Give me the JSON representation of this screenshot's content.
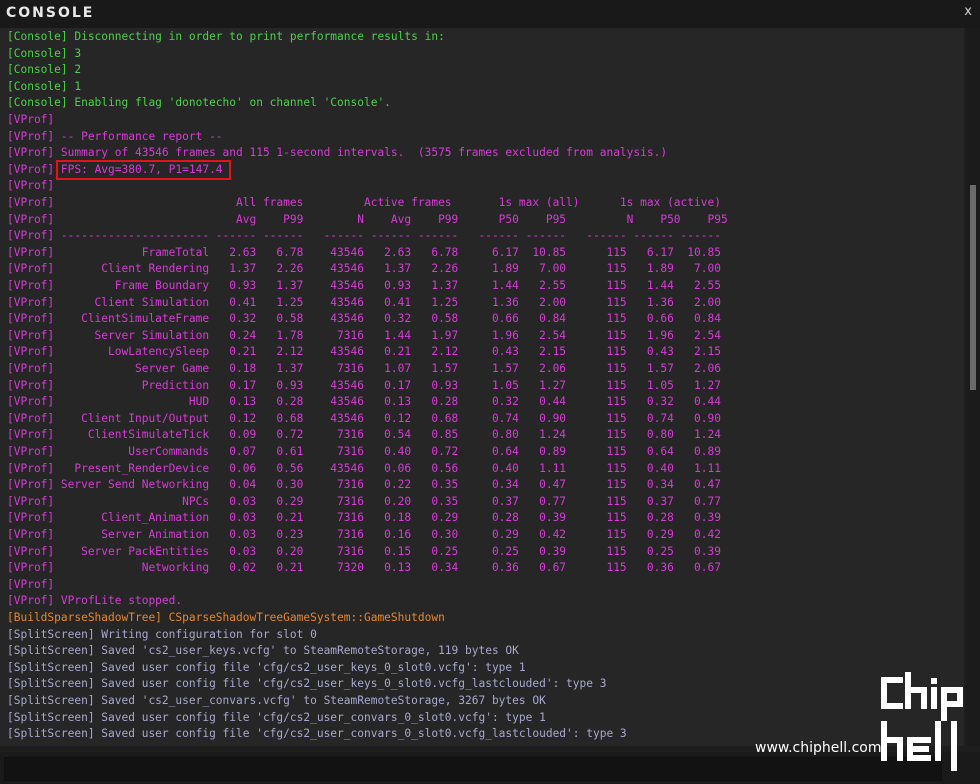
{
  "window": {
    "title": "CONSOLE",
    "close_label": "x"
  },
  "colors": {
    "console_green": "#4ad24a",
    "vprof_magenta": "#d63cd6",
    "shadow_orange": "#e8862a",
    "splitscreen_lavender": "#a8a8cf",
    "highlight_red": "#e0151b",
    "background": "#262626"
  },
  "console_lines": [
    "[Console] Disconnecting in order to print performance results in:",
    "[Console] 3",
    "[Console] 2",
    "[Console] 1",
    "[Console] Enabling flag 'donotecho' on channel 'Console'."
  ],
  "vprof_intro": [
    "[VProf]",
    "[VProf] -- Performance report --",
    "[VProf] Summary of 43546 frames and 115 1-second intervals.  (3575 frames excluded from analysis.)"
  ],
  "fps": {
    "prefix": "[VProf] ",
    "text": "FPS: Avg=380.7, P1=147.4"
  },
  "blank_vprof": "[VProf]",
  "table": {
    "header1": "[VProf]                           All frames         Active frames       1s max (all)      1s max (active)",
    "header2": "[VProf]                           Avg    P99        N    Avg    P99      P50    P95         N    P50    P95",
    "separator": "[VProf] ---------------------- ------ ------   ------ ------ ------   ------ ------   ------ ------ ------",
    "rows": [
      {
        "name": "FrameTotal",
        "avg": "2.63",
        "p99": "6.78",
        "n": "43546",
        "act_avg": "2.63",
        "act_p99": "6.78",
        "max_p50": "6.17",
        "max_p95": "10.85",
        "act_n": "115",
        "act_p50": "6.17",
        "act_p95": "10.85"
      },
      {
        "name": "Client Rendering",
        "avg": "1.37",
        "p99": "2.26",
        "n": "43546",
        "act_avg": "1.37",
        "act_p99": "2.26",
        "max_p50": "1.89",
        "max_p95": "7.00",
        "act_n": "115",
        "act_p50": "1.89",
        "act_p95": "7.00"
      },
      {
        "name": "Frame Boundary",
        "avg": "0.93",
        "p99": "1.37",
        "n": "43546",
        "act_avg": "0.93",
        "act_p99": "1.37",
        "max_p50": "1.44",
        "max_p95": "2.55",
        "act_n": "115",
        "act_p50": "1.44",
        "act_p95": "2.55"
      },
      {
        "name": "Client Simulation",
        "avg": "0.41",
        "p99": "1.25",
        "n": "43546",
        "act_avg": "0.41",
        "act_p99": "1.25",
        "max_p50": "1.36",
        "max_p95": "2.00",
        "act_n": "115",
        "act_p50": "1.36",
        "act_p95": "2.00"
      },
      {
        "name": "ClientSimulateFrame",
        "avg": "0.32",
        "p99": "0.58",
        "n": "43546",
        "act_avg": "0.32",
        "act_p99": "0.58",
        "max_p50": "0.66",
        "max_p95": "0.84",
        "act_n": "115",
        "act_p50": "0.66",
        "act_p95": "0.84"
      },
      {
        "name": "Server Simulation",
        "avg": "0.24",
        "p99": "1.78",
        "n": "7316",
        "act_avg": "1.44",
        "act_p99": "1.97",
        "max_p50": "1.96",
        "max_p95": "2.54",
        "act_n": "115",
        "act_p50": "1.96",
        "act_p95": "2.54"
      },
      {
        "name": "LowLatencySleep",
        "avg": "0.21",
        "p99": "2.12",
        "n": "43546",
        "act_avg": "0.21",
        "act_p99": "2.12",
        "max_p50": "0.43",
        "max_p95": "2.15",
        "act_n": "115",
        "act_p50": "0.43",
        "act_p95": "2.15"
      },
      {
        "name": "Server Game",
        "avg": "0.18",
        "p99": "1.37",
        "n": "7316",
        "act_avg": "1.07",
        "act_p99": "1.57",
        "max_p50": "1.57",
        "max_p95": "2.06",
        "act_n": "115",
        "act_p50": "1.57",
        "act_p95": "2.06"
      },
      {
        "name": "Prediction",
        "avg": "0.17",
        "p99": "0.93",
        "n": "43546",
        "act_avg": "0.17",
        "act_p99": "0.93",
        "max_p50": "1.05",
        "max_p95": "1.27",
        "act_n": "115",
        "act_p50": "1.05",
        "act_p95": "1.27"
      },
      {
        "name": "HUD",
        "avg": "0.13",
        "p99": "0.28",
        "n": "43546",
        "act_avg": "0.13",
        "act_p99": "0.28",
        "max_p50": "0.32",
        "max_p95": "0.44",
        "act_n": "115",
        "act_p50": "0.32",
        "act_p95": "0.44"
      },
      {
        "name": "Client Input/Output",
        "avg": "0.12",
        "p99": "0.68",
        "n": "43546",
        "act_avg": "0.12",
        "act_p99": "0.68",
        "max_p50": "0.74",
        "max_p95": "0.90",
        "act_n": "115",
        "act_p50": "0.74",
        "act_p95": "0.90"
      },
      {
        "name": "ClientSimulateTick",
        "avg": "0.09",
        "p99": "0.72",
        "n": "7316",
        "act_avg": "0.54",
        "act_p99": "0.85",
        "max_p50": "0.80",
        "max_p95": "1.24",
        "act_n": "115",
        "act_p50": "0.80",
        "act_p95": "1.24"
      },
      {
        "name": "UserCommands",
        "avg": "0.07",
        "p99": "0.61",
        "n": "7316",
        "act_avg": "0.40",
        "act_p99": "0.72",
        "max_p50": "0.64",
        "max_p95": "0.89",
        "act_n": "115",
        "act_p50": "0.64",
        "act_p95": "0.89"
      },
      {
        "name": "Present_RenderDevice",
        "avg": "0.06",
        "p99": "0.56",
        "n": "43546",
        "act_avg": "0.06",
        "act_p99": "0.56",
        "max_p50": "0.40",
        "max_p95": "1.11",
        "act_n": "115",
        "act_p50": "0.40",
        "act_p95": "1.11"
      },
      {
        "name": "Server Send Networking",
        "avg": "0.04",
        "p99": "0.30",
        "n": "7316",
        "act_avg": "0.22",
        "act_p99": "0.35",
        "max_p50": "0.34",
        "max_p95": "0.47",
        "act_n": "115",
        "act_p50": "0.34",
        "act_p95": "0.47"
      },
      {
        "name": "NPCs",
        "avg": "0.03",
        "p99": "0.29",
        "n": "7316",
        "act_avg": "0.20",
        "act_p99": "0.35",
        "max_p50": "0.37",
        "max_p95": "0.77",
        "act_n": "115",
        "act_p50": "0.37",
        "act_p95": "0.77"
      },
      {
        "name": "Client_Animation",
        "avg": "0.03",
        "p99": "0.21",
        "n": "7316",
        "act_avg": "0.18",
        "act_p99": "0.29",
        "max_p50": "0.28",
        "max_p95": "0.39",
        "act_n": "115",
        "act_p50": "0.28",
        "act_p95": "0.39"
      },
      {
        "name": "Server Animation",
        "avg": "0.03",
        "p99": "0.23",
        "n": "7316",
        "act_avg": "0.16",
        "act_p99": "0.30",
        "max_p50": "0.29",
        "max_p95": "0.42",
        "act_n": "115",
        "act_p50": "0.29",
        "act_p95": "0.42"
      },
      {
        "name": "Server PackEntities",
        "avg": "0.03",
        "p99": "0.20",
        "n": "7316",
        "act_avg": "0.15",
        "act_p99": "0.25",
        "max_p50": "0.25",
        "max_p95": "0.39",
        "act_n": "115",
        "act_p50": "0.25",
        "act_p95": "0.39"
      },
      {
        "name": "Networking",
        "avg": "0.02",
        "p99": "0.21",
        "n": "7320",
        "act_avg": "0.13",
        "act_p99": "0.34",
        "max_p50": "0.36",
        "max_p95": "0.67",
        "act_n": "115",
        "act_p50": "0.36",
        "act_p95": "0.67"
      }
    ]
  },
  "vprof_outro": [
    "[VProf]",
    "[VProf] VProfLite stopped."
  ],
  "shadow_line": "[BuildSparseShadowTree] CSparseShadowTreeGameSystem::GameShutdown",
  "split_lines": [
    "[SplitScreen] Writing configuration for slot 0",
    "[SplitScreen] Saved 'cs2_user_keys.vcfg' to SteamRemoteStorage, 119 bytes OK",
    "[SplitScreen] Saved user config file 'cfg/cs2_user_keys_0_slot0.vcfg': type 1",
    "[SplitScreen] Saved user config file 'cfg/cs2_user_keys_0_slot0.vcfg_lastclouded': type 3",
    "[SplitScreen] Saved 'cs2_user_convars.vcfg' to SteamRemoteStorage, 3267 bytes OK",
    "[SplitScreen] Saved user config file 'cfg/cs2_user_convars_0_slot0.vcfg': type 1",
    "[SplitScreen] Saved user config file 'cfg/cs2_user_convars_0_slot0.vcfg_lastclouded': type 3"
  ],
  "watermark": {
    "site": "www.chiphell.com",
    "logo": "chip hell"
  }
}
